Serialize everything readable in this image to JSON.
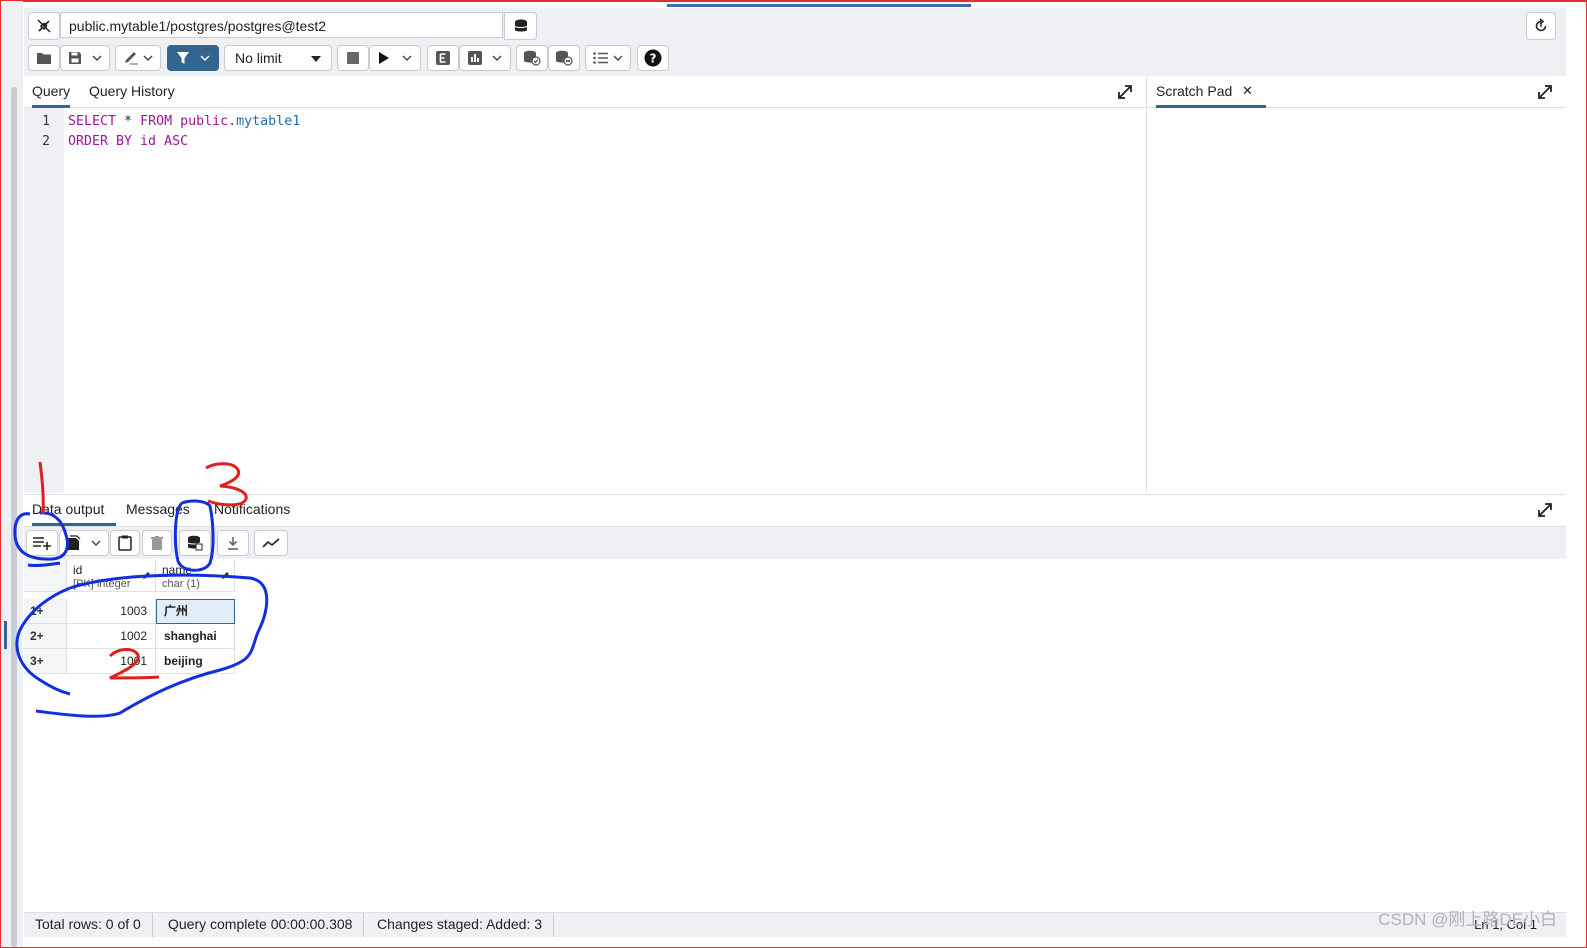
{
  "connection": {
    "value": "public.mytable1/postgres/postgres@test2"
  },
  "toolbar": {
    "limit_label": "No limit"
  },
  "editor": {
    "tabs": [
      "Query",
      "Query History"
    ],
    "line_numbers": [
      "1",
      "2"
    ],
    "lines": [
      {
        "kw1": "SELECT",
        "mid": " * ",
        "kw2": "FROM",
        "schema": " public.",
        "table": "mytable1"
      },
      {
        "kw1": "ORDER BY",
        "mid": " id ",
        "kw2": "ASC"
      }
    ]
  },
  "scratch": {
    "tab_label": "Scratch Pad",
    "close": "✕"
  },
  "output": {
    "tabs": [
      "Data output",
      "Messages",
      "Notifications"
    ],
    "columns": [
      {
        "name": "id",
        "type": "[PK] integer"
      },
      {
        "name": "name",
        "type": "char (1)"
      }
    ],
    "rows": [
      {
        "num": "1+",
        "id": "1003",
        "name": "广州"
      },
      {
        "num": "2+",
        "id": "1002",
        "name": "shanghai"
      },
      {
        "num": "3+",
        "id": "1001",
        "name": "beijing"
      }
    ]
  },
  "status": {
    "total_rows": "Total rows: 0 of 0",
    "query_complete": "Query complete 00:00:00.308",
    "changes": "Changes staged: Added: 3",
    "cursor": "Ln 1, Col 1"
  },
  "watermark": "CSDN @刚上路DE小白",
  "annotations": [
    "1",
    "2",
    "3"
  ],
  "colors": {
    "accent": "#326690",
    "annotation_blue": "#1030e0",
    "annotation_red": "#e02020",
    "keyword": "#a0169a",
    "table": "#1f6fb0"
  }
}
